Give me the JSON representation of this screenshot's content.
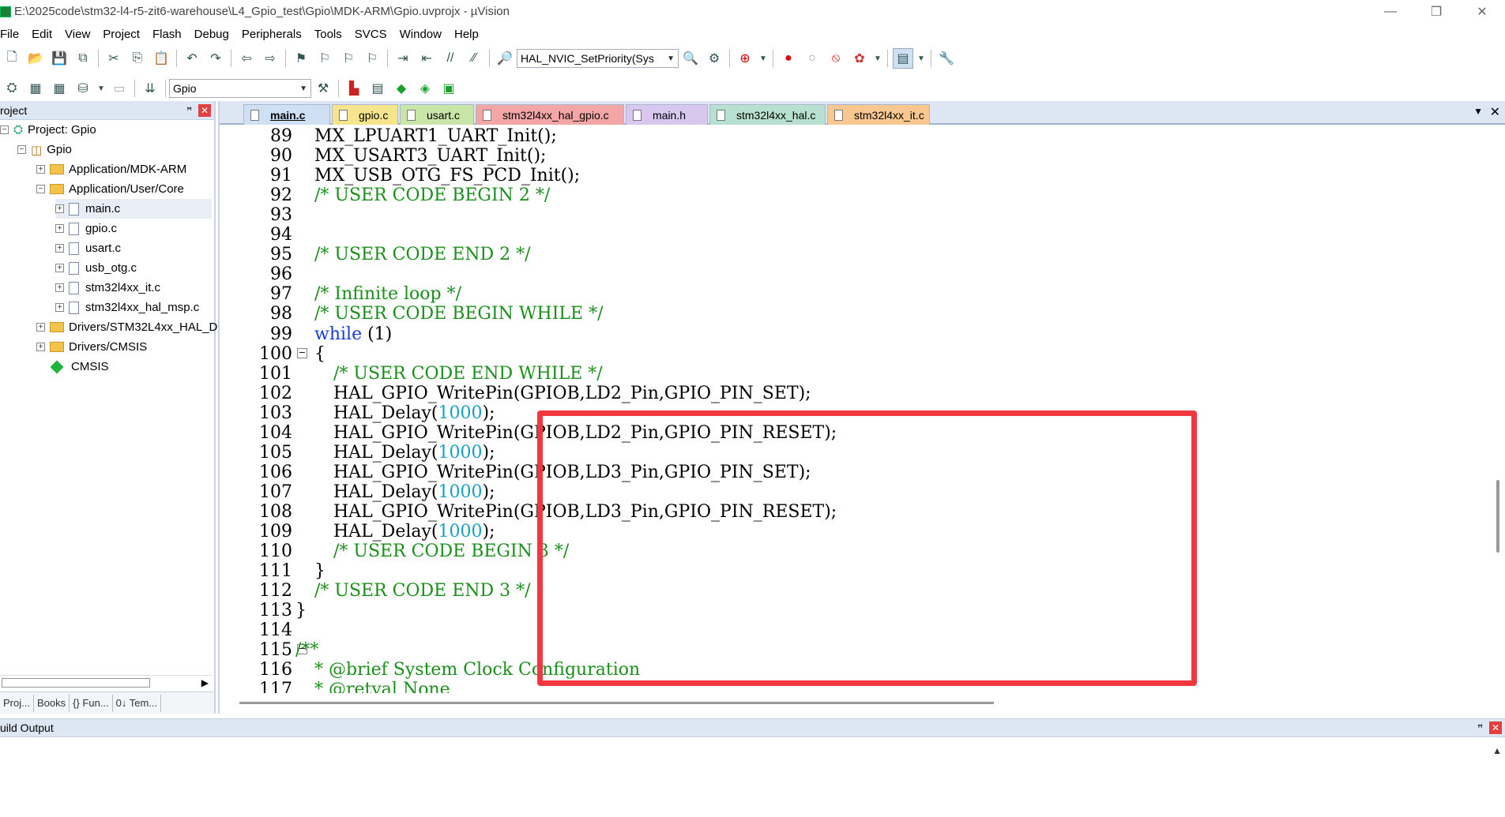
{
  "window": {
    "title": "E:\\2025code\\stm32-l4-r5-zit6-warehouse\\L4_Gpio_test\\Gpio\\MDK-ARM\\Gpio.uvprojx - µVision",
    "minimize": "—",
    "restore": "❐",
    "close": "✕"
  },
  "menu": [
    "File",
    "Edit",
    "View",
    "Project",
    "Flash",
    "Debug",
    "Peripherals",
    "Tools",
    "SVCS",
    "Window",
    "Help"
  ],
  "toolbar": {
    "function_combo": "HAL_NVIC_SetPriority(Sys",
    "target_combo": "Gpio"
  },
  "project_panel": {
    "title": "roject",
    "pin": "ꟸ",
    "close": "✕",
    "tree": [
      {
        "label": "Project: Gpio",
        "kind": "project",
        "toggle": "−"
      },
      {
        "label": "Gpio",
        "kind": "target",
        "toggle": "−"
      },
      {
        "label": "Application/MDK-ARM",
        "kind": "folder",
        "toggle": "+"
      },
      {
        "label": "Application/User/Core",
        "kind": "folder",
        "toggle": "−"
      },
      {
        "label": "main.c",
        "kind": "file",
        "toggle": "+"
      },
      {
        "label": "gpio.c",
        "kind": "file",
        "toggle": "+"
      },
      {
        "label": "usart.c",
        "kind": "file",
        "toggle": "+"
      },
      {
        "label": "usb_otg.c",
        "kind": "file",
        "toggle": "+"
      },
      {
        "label": "stm32l4xx_it.c",
        "kind": "file",
        "toggle": "+"
      },
      {
        "label": "stm32l4xx_hal_msp.c",
        "kind": "file",
        "toggle": "+"
      },
      {
        "label": "Drivers/STM32L4xx_HAL_D",
        "kind": "folder",
        "toggle": "+"
      },
      {
        "label": "Drivers/CMSIS",
        "kind": "folder",
        "toggle": "+"
      },
      {
        "label": "CMSIS",
        "kind": "component",
        "toggle": ""
      }
    ],
    "tabs": [
      "Proj...",
      "Books",
      "{} Fun...",
      "0↓ Tem..."
    ]
  },
  "editor": {
    "tabs": [
      {
        "label": "main.c",
        "color": "#cfe0f5",
        "active": true
      },
      {
        "label": "gpio.c",
        "color": "#f6e58d",
        "active": false
      },
      {
        "label": "usart.c",
        "color": "#c9e6a8",
        "active": false
      },
      {
        "label": "stm32l4xx_hal_gpio.c",
        "color": "#f4a6a6",
        "active": false
      },
      {
        "label": "main.h",
        "color": "#d8c8f0",
        "active": false
      },
      {
        "label": "stm32l4xx_hal.c",
        "color": "#b8e0d0",
        "active": false
      },
      {
        "label": "stm32l4xx_it.c",
        "color": "#f8c890",
        "active": false
      }
    ],
    "lines": [
      {
        "n": "89",
        "fold": "",
        "indent": 1,
        "parts": [
          [
            "plain",
            "MX_LPUART1_UART_Init();"
          ]
        ]
      },
      {
        "n": "90",
        "fold": "",
        "indent": 1,
        "parts": [
          [
            "plain",
            "MX_USART3_UART_Init();"
          ]
        ]
      },
      {
        "n": "91",
        "fold": "",
        "indent": 1,
        "parts": [
          [
            "plain",
            "MX_USB_OTG_FS_PCD_Init();"
          ]
        ]
      },
      {
        "n": "92",
        "fold": "",
        "indent": 1,
        "parts": [
          [
            "cm",
            "/* USER CODE BEGIN 2 */"
          ]
        ]
      },
      {
        "n": "93",
        "fold": "",
        "indent": 0,
        "parts": []
      },
      {
        "n": "94",
        "fold": "",
        "indent": 0,
        "parts": []
      },
      {
        "n": "95",
        "fold": "",
        "indent": 1,
        "parts": [
          [
            "cm",
            "/* USER CODE END 2 */"
          ]
        ]
      },
      {
        "n": "96",
        "fold": "",
        "indent": 0,
        "parts": []
      },
      {
        "n": "97",
        "fold": "",
        "indent": 1,
        "parts": [
          [
            "cm",
            "/* Infinite loop */"
          ]
        ]
      },
      {
        "n": "98",
        "fold": "",
        "indent": 1,
        "parts": [
          [
            "cm",
            "/* USER CODE BEGIN WHILE */"
          ]
        ]
      },
      {
        "n": "99",
        "fold": "",
        "indent": 1,
        "parts": [
          [
            "kw",
            "while"
          ],
          [
            "plain",
            " (1)"
          ]
        ]
      },
      {
        "n": "100",
        "fold": "−",
        "indent": 1,
        "parts": [
          [
            "plain",
            "{"
          ]
        ]
      },
      {
        "n": "101",
        "fold": "",
        "indent": 2,
        "parts": [
          [
            "cm",
            "/* USER CODE END WHILE */"
          ]
        ]
      },
      {
        "n": "102",
        "fold": "",
        "indent": 2,
        "parts": [
          [
            "plain",
            "HAL_GPIO_WritePin(GPIOB,LD2_Pin,GPIO_PIN_SET);"
          ]
        ]
      },
      {
        "n": "103",
        "fold": "",
        "indent": 2,
        "parts": [
          [
            "plain",
            "HAL_Delay("
          ],
          [
            "num",
            "1000"
          ],
          [
            "plain",
            ");"
          ]
        ]
      },
      {
        "n": "104",
        "fold": "",
        "indent": 2,
        "parts": [
          [
            "plain",
            "HAL_GPIO_WritePin(GPIOB,LD2_Pin,GPIO_PIN_RESET);"
          ]
        ]
      },
      {
        "n": "105",
        "fold": "",
        "indent": 2,
        "parts": [
          [
            "plain",
            "HAL_Delay("
          ],
          [
            "num",
            "1000"
          ],
          [
            "plain",
            ");"
          ]
        ]
      },
      {
        "n": "106",
        "fold": "",
        "indent": 2,
        "parts": [
          [
            "plain",
            "HAL_GPIO_WritePin(GPIOB,LD3_Pin,GPIO_PIN_SET);"
          ]
        ]
      },
      {
        "n": "107",
        "fold": "",
        "indent": 2,
        "parts": [
          [
            "plain",
            "HAL_Delay("
          ],
          [
            "num",
            "1000"
          ],
          [
            "plain",
            ");"
          ]
        ]
      },
      {
        "n": "108",
        "fold": "",
        "indent": 2,
        "parts": [
          [
            "plain",
            "HAL_GPIO_WritePin(GPIOB,LD3_Pin,GPIO_PIN_RESET);"
          ]
        ]
      },
      {
        "n": "109",
        "fold": "",
        "indent": 2,
        "parts": [
          [
            "plain",
            "HAL_Delay("
          ],
          [
            "num",
            "1000"
          ],
          [
            "plain",
            ");"
          ]
        ]
      },
      {
        "n": "110",
        "fold": "",
        "indent": 2,
        "parts": [
          [
            "cm",
            "/* USER CODE BEGIN 3 */"
          ]
        ]
      },
      {
        "n": "111",
        "fold": "",
        "indent": 1,
        "parts": [
          [
            "plain",
            "}"
          ]
        ]
      },
      {
        "n": "112",
        "fold": "",
        "indent": 1,
        "parts": [
          [
            "cm",
            "/* USER CODE END 3 */"
          ]
        ]
      },
      {
        "n": "113",
        "fold": "",
        "indent": 0,
        "parts": [
          [
            "plain",
            "}"
          ]
        ]
      },
      {
        "n": "114",
        "fold": "",
        "indent": 0,
        "parts": []
      },
      {
        "n": "115",
        "fold": "−",
        "indent": 0,
        "parts": [
          [
            "cm",
            "/**"
          ]
        ]
      },
      {
        "n": "116",
        "fold": "",
        "indent": 1,
        "parts": [
          [
            "cm",
            "* @brief System Clock Configuration"
          ]
        ]
      },
      {
        "n": "117",
        "fold": "",
        "indent": 1,
        "parts": [
          [
            "cm",
            "* @retval None"
          ]
        ]
      }
    ]
  },
  "build_output": {
    "title": "uild Output",
    "pin": "ꟸ",
    "close": "✕"
  },
  "colors": {
    "comment": "#1a8f1a",
    "keyword": "#1a3bdc",
    "number": "#19a0c8",
    "highlight_box": "#f0383e"
  }
}
